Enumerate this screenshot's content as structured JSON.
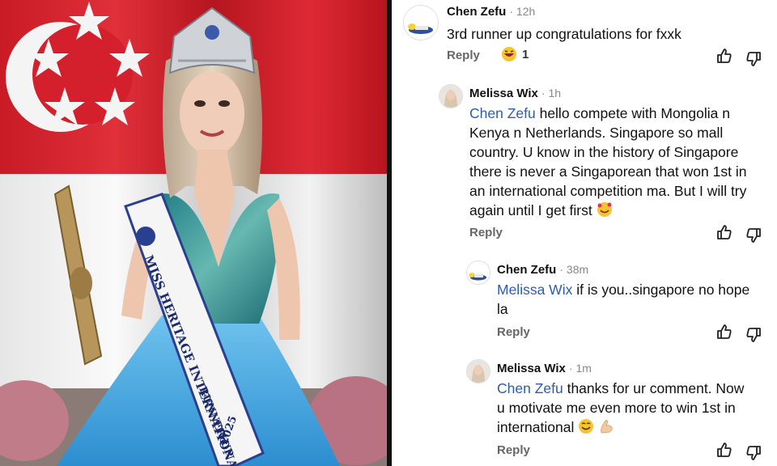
{
  "sash": {
    "line1": "MISS HERITAGE INTERNATIONAL",
    "line2": "RUNNER UP",
    "year": "2025"
  },
  "comments": [
    {
      "author": "Chen Zefu",
      "time": "12h",
      "text": "3rd runner up congratulations for fxxk",
      "reply_label": "Reply",
      "reaction_count": "1",
      "avatar_icon": "sleeping-figure-avatar"
    },
    {
      "author": "Melissa Wix",
      "time": "1h",
      "mention": "Chen Zefu",
      "text_lines": [
        " hello compete with Mongolia n",
        "Kenya n Netherlands. Singapore so mall",
        "country. U know in the history of Singapore",
        "there is never a Singaporean that won 1st in",
        "an international competition ma. But I will try",
        "again until I get first"
      ],
      "reply_label": "Reply",
      "avatar_icon": "profile-photo-avatar"
    },
    {
      "author": "Chen Zefu",
      "time": "38m",
      "mention": "Melissa Wix",
      "text_lines": [
        " if is you..singapore no hope",
        "la"
      ],
      "reply_label": "Reply",
      "avatar_icon": "sleeping-figure-avatar"
    },
    {
      "author": "Melissa Wix",
      "time": "1m",
      "mention": "Chen Zefu",
      "text_lines": [
        " thanks for ur comment. Now",
        "u motivate me even more to win 1st in",
        "international"
      ],
      "reply_label": "Reply",
      "avatar_icon": "profile-photo-avatar"
    }
  ],
  "colors": {
    "flag_red": "#d4202c",
    "mention_blue": "#2a5db0",
    "gown_blue": "#3a9bd6"
  }
}
